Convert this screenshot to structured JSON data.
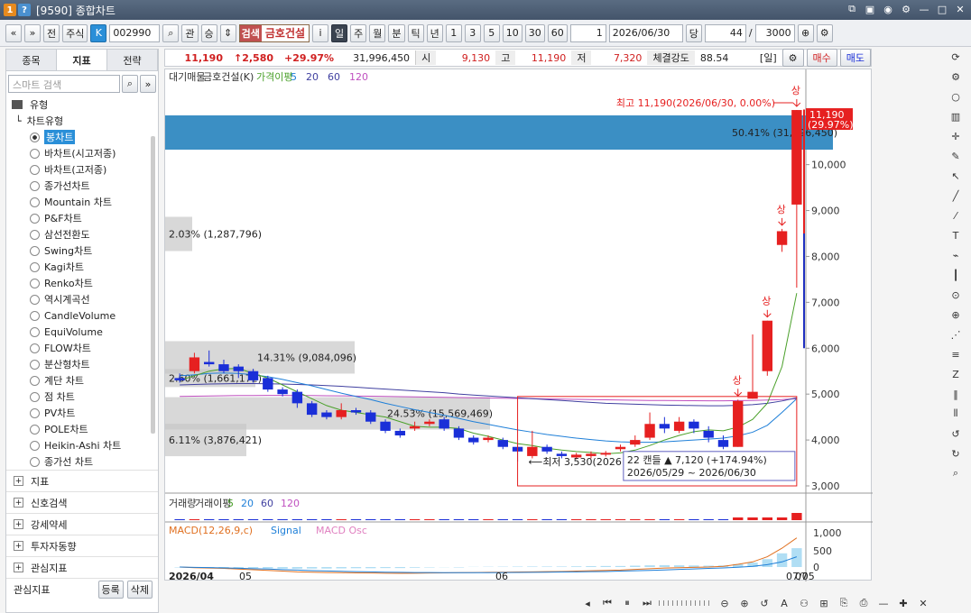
{
  "window": {
    "title": "[9590] 종합차트"
  },
  "toolbar": {
    "nav_prev": "«",
    "nav_dd": "»",
    "jeon": "전",
    "stock_type": "주식",
    "k_badge": "K",
    "code": "002990",
    "search": "⌕",
    "gwan": "관",
    "sang": "승",
    "name_tag": "검색",
    "name": "금호건설",
    "info": "i",
    "periods": [
      "일",
      "주",
      "월",
      "분",
      "틱",
      "년"
    ],
    "nums": [
      "1",
      "3",
      "5",
      "10",
      "30",
      "60"
    ],
    "unit_count": "1",
    "date": "2026/06/30",
    "dang": "당",
    "count": "44",
    "slash": "/",
    "max": "3000"
  },
  "sidebar": {
    "tabs": [
      "종목",
      "지표",
      "전략"
    ],
    "search_placeholder": "스마트 검색",
    "type_label": "유형",
    "chart_type_label": "차트유형",
    "items": [
      "봉차트",
      "바차트(시고저종)",
      "바차트(고저종)",
      "종가선차트",
      "Mountain 차트",
      "P&F차트",
      "삼선전환도",
      "Swing차트",
      "Kagi차트",
      "Renko차트",
      "역시계곡선",
      "CandleVolume",
      "EquiVolume",
      "FLOW차트",
      "분산형차트",
      "계단 차트",
      "점 차트",
      "PV차트",
      "POLE차트",
      "Heikin-Ashi 차트",
      "종가선 차트"
    ],
    "categories": [
      "지표",
      "신호검색",
      "강세약세",
      "투자자동향",
      "관심지표"
    ],
    "footer_label": "관심지표",
    "register": "등록",
    "delete": "삭제"
  },
  "quote": {
    "price": "11,190",
    "change": "↑2,580",
    "pct": "+29.97%",
    "volume": "31,996,450",
    "open_l": "시",
    "open": "9,130",
    "high_l": "고",
    "high": "11,190",
    "low_l": "저",
    "low": "7,320",
    "strength_l": "체결강도",
    "strength": "88.54",
    "period": "[일]",
    "sell": "매수",
    "buy": "매도"
  },
  "chart_data": {
    "type": "candlestick",
    "title": "",
    "legend": [
      "대기매물",
      "금호건설(K)",
      "가격이평",
      "5",
      "20",
      "60",
      "120"
    ],
    "ylim": [
      3000,
      11800
    ],
    "yticks": [
      3000,
      4000,
      5000,
      6000,
      7000,
      8000,
      9000,
      10000
    ],
    "ytick_labels": [
      "3,000",
      "4,000",
      "5,000",
      "6,000",
      "7,000",
      "8,000",
      "9,000",
      "10,000"
    ],
    "xlabels": [
      "2026/04",
      "05",
      "06",
      "07",
      "07/05"
    ],
    "candles": [
      {
        "o": 5350,
        "c": 5300,
        "h": 5450,
        "l": 5250
      },
      {
        "o": 5500,
        "c": 5800,
        "h": 5900,
        "l": 5450
      },
      {
        "o": 5700,
        "c": 5650,
        "h": 5950,
        "l": 5600
      },
      {
        "o": 5650,
        "c": 5500,
        "h": 5750,
        "l": 5450
      },
      {
        "o": 5600,
        "c": 5500,
        "h": 5650,
        "l": 5350
      },
      {
        "o": 5500,
        "c": 5300,
        "h": 5550,
        "l": 5250
      },
      {
        "o": 5350,
        "c": 5100,
        "h": 5400,
        "l": 5050
      },
      {
        "o": 5100,
        "c": 5000,
        "h": 5150,
        "l": 4950
      },
      {
        "o": 5050,
        "c": 4800,
        "h": 5100,
        "l": 4700
      },
      {
        "o": 4800,
        "c": 4550,
        "h": 4850,
        "l": 4500
      },
      {
        "o": 4600,
        "c": 4500,
        "h": 4650,
        "l": 4450
      },
      {
        "o": 4500,
        "c": 4650,
        "h": 4800,
        "l": 4450
      },
      {
        "o": 4650,
        "c": 4600,
        "h": 4700,
        "l": 4550
      },
      {
        "o": 4600,
        "c": 4400,
        "h": 4650,
        "l": 4350
      },
      {
        "o": 4400,
        "c": 4200,
        "h": 4450,
        "l": 4150
      },
      {
        "o": 4200,
        "c": 4100,
        "h": 4250,
        "l": 4050
      },
      {
        "o": 4250,
        "c": 4300,
        "h": 4400,
        "l": 4200
      },
      {
        "o": 4350,
        "c": 4400,
        "h": 4450,
        "l": 4300
      },
      {
        "o": 4450,
        "c": 4250,
        "h": 4500,
        "l": 4200
      },
      {
        "o": 4250,
        "c": 4050,
        "h": 4300,
        "l": 4000
      },
      {
        "o": 4050,
        "c": 3950,
        "h": 4100,
        "l": 3900
      },
      {
        "o": 4000,
        "c": 4050,
        "h": 4100,
        "l": 3950
      },
      {
        "o": 4000,
        "c": 3850,
        "h": 4050,
        "l": 3800
      },
      {
        "o": 3850,
        "c": 3750,
        "h": 3900,
        "l": 3530
      },
      {
        "o": 3650,
        "c": 3850,
        "h": 4200,
        "l": 3600
      },
      {
        "o": 3850,
        "c": 3750,
        "h": 3900,
        "l": 3700
      },
      {
        "o": 3700,
        "c": 3650,
        "h": 3750,
        "l": 3600
      },
      {
        "o": 3620,
        "c": 3680,
        "h": 3720,
        "l": 3580
      },
      {
        "o": 3650,
        "c": 3700,
        "h": 3750,
        "l": 3600
      },
      {
        "o": 3680,
        "c": 3720,
        "h": 3760,
        "l": 3640
      },
      {
        "o": 3800,
        "c": 3850,
        "h": 3900,
        "l": 3750
      },
      {
        "o": 3900,
        "c": 4000,
        "h": 4100,
        "l": 3850
      },
      {
        "o": 4050,
        "c": 4350,
        "h": 4600,
        "l": 4000
      },
      {
        "o": 4350,
        "c": 4250,
        "h": 4500,
        "l": 4150
      },
      {
        "o": 4200,
        "c": 4400,
        "h": 4500,
        "l": 4150
      },
      {
        "o": 4400,
        "c": 4250,
        "h": 4450,
        "l": 4150
      },
      {
        "o": 4200,
        "c": 4050,
        "h": 4300,
        "l": 3950
      },
      {
        "o": 4000,
        "c": 3850,
        "h": 4100,
        "l": 3800
      },
      {
        "o": 3850,
        "c": 4850,
        "h": 4880,
        "l": 3850
      },
      {
        "o": 4900,
        "c": 5050,
        "h": 6300,
        "l": 4900
      },
      {
        "o": 5500,
        "c": 6600,
        "h": 6600,
        "l": 5400
      },
      {
        "o": 8250,
        "c": 8550,
        "h": 8600,
        "l": 8100
      },
      {
        "o": 9130,
        "c": 11190,
        "h": 11190,
        "l": 7320
      }
    ],
    "ma5": [
      5300,
      5400,
      5500,
      5550,
      5560,
      5450,
      5350,
      5200,
      5050,
      4900,
      4750,
      4650,
      4600,
      4550,
      4500,
      4400,
      4300,
      4280,
      4280,
      4250,
      4150,
      4080,
      4000,
      3920,
      3880,
      3820,
      3780,
      3750,
      3730,
      3700,
      3720,
      3780,
      3880,
      4000,
      4100,
      4180,
      4220,
      4200,
      4280,
      4450,
      4800,
      5600,
      7200
    ],
    "ma20": [
      5400,
      5420,
      5450,
      5460,
      5450,
      5420,
      5380,
      5320,
      5250,
      5180,
      5100,
      5020,
      4950,
      4880,
      4800,
      4730,
      4660,
      4600,
      4540,
      4470,
      4400,
      4340,
      4280,
      4220,
      4170,
      4120,
      4080,
      4040,
      4010,
      3980,
      3960,
      3950,
      3950,
      3960,
      3980,
      4000,
      4020,
      4040,
      4090,
      4170,
      4320,
      4600,
      4900
    ],
    "ma60": [
      5200,
      5210,
      5220,
      5225,
      5230,
      5230,
      5225,
      5220,
      5210,
      5200,
      5185,
      5170,
      5150,
      5130,
      5110,
      5090,
      5070,
      5050,
      5030,
      5000,
      4980,
      4960,
      4940,
      4920,
      4900,
      4880,
      4860,
      4840,
      4820,
      4800,
      4790,
      4780,
      4770,
      4760,
      4755,
      4750,
      4745,
      4745,
      4755,
      4770,
      4800,
      4850,
      4920
    ],
    "ma120": [
      4950,
      4955,
      4960,
      4965,
      4968,
      4970,
      4972,
      4972,
      4970,
      4968,
      4965,
      4962,
      4958,
      4955,
      4950,
      4945,
      4940,
      4935,
      4930,
      4925,
      4920,
      4915,
      4910,
      4905,
      4900,
      4895,
      4890,
      4885,
      4880,
      4875,
      4870,
      4866,
      4862,
      4860,
      4858,
      4856,
      4855,
      4855,
      4858,
      4862,
      4870,
      4880,
      4900
    ],
    "profile": [
      {
        "price": 10700,
        "pct": "50.41%",
        "vol": "(31,996,450)"
      },
      {
        "price": 8490,
        "pct": "2.03%",
        "vol": "(1,287,796)"
      },
      {
        "price": 5800,
        "pct": "14.31%",
        "vol": "(9,084,096)"
      },
      {
        "price": 4580,
        "pct": "24.53%",
        "vol": "(15,569,469)"
      },
      {
        "price": 4000,
        "pct": "6.11%",
        "vol": "(3,876,421)"
      },
      {
        "price": 5350,
        "pct": "2.60%",
        "vol": "(1,661,172)"
      }
    ],
    "high_label": "최고 11,190(2026/06/30, 0.00%)",
    "low_label": "최저 3,530(2026",
    "price_tag": [
      "11,190",
      "(29.97%)"
    ],
    "range_box": [
      "22 캔들",
      "▲ 7,120 (+174.94%)",
      "2026/05/29 ~ 2026/06/30"
    ],
    "sang": "상",
    "volume_legend": [
      "거래량",
      "거래이평",
      "5",
      "20",
      "60",
      "120"
    ],
    "macd_legend": [
      "MACD(12,26,9,c)",
      "Signal",
      "MACD Osc"
    ],
    "macd_ticks": [
      "1,000",
      "500",
      "0"
    ],
    "macd": [
      0,
      -20,
      -30,
      -40,
      -60,
      -80,
      -100,
      -120,
      -140,
      -150,
      -160,
      -165,
      -170,
      -175,
      -180,
      -185,
      -180,
      -175,
      -170,
      -165,
      -160,
      -155,
      -150,
      -145,
      -140,
      -135,
      -130,
      -120,
      -110,
      -100,
      -90,
      -70,
      -50,
      -30,
      -20,
      -10,
      0,
      20,
      80,
      150,
      300,
      550,
      850
    ],
    "signal": [
      0,
      -10,
      -15,
      -25,
      -35,
      -50,
      -60,
      -75,
      -90,
      -105,
      -115,
      -125,
      -135,
      -140,
      -150,
      -155,
      -160,
      -162,
      -164,
      -165,
      -165,
      -163,
      -160,
      -158,
      -155,
      -150,
      -145,
      -140,
      -135,
      -130,
      -120,
      -110,
      -100,
      -85,
      -70,
      -55,
      -40,
      -25,
      -5,
      20,
      70,
      150,
      300
    ],
    "colors": {
      "up": "#e62020",
      "down": "#1a2fd8",
      "ma5": "#4aa02a",
      "ma20": "#1e7fd8",
      "ma60": "#4040a0",
      "ma120": "#c050c0",
      "profile": "#c8c8c8",
      "profile_top": "#3b8fc4"
    }
  }
}
